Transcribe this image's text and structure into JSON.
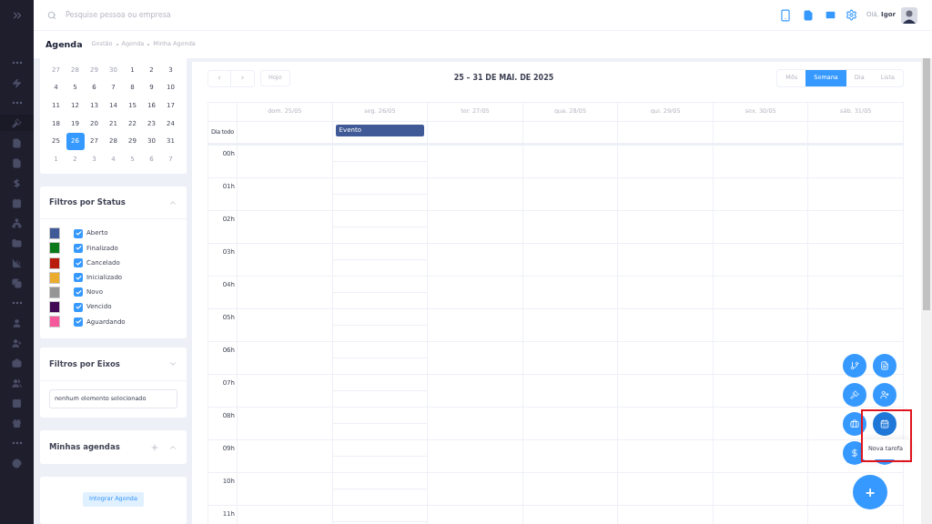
{
  "search": {
    "placeholder": "Pesquise pessoa ou empresa"
  },
  "greeting": "Olá, **Igor**",
  "page": {
    "title": "Agenda",
    "breadcrumb": [
      "Gestão",
      "Agenda",
      "Minha Agenda"
    ]
  },
  "mini_calendar": {
    "weeks": [
      [
        {
          "d": "27",
          "other": true,
          "selected": false
        },
        {
          "d": "28",
          "other": true,
          "selected": false
        },
        {
          "d": "29",
          "other": true,
          "selected": false
        },
        {
          "d": "30",
          "other": true,
          "selected": false
        },
        {
          "d": "1",
          "other": false,
          "selected": false
        },
        {
          "d": "2",
          "other": false,
          "selected": false
        },
        {
          "d": "3",
          "other": false,
          "selected": false
        }
      ],
      [
        {
          "d": "4",
          "other": false,
          "selected": false
        },
        {
          "d": "5",
          "other": false,
          "selected": false
        },
        {
          "d": "6",
          "other": false,
          "selected": false
        },
        {
          "d": "7",
          "other": false,
          "selected": false
        },
        {
          "d": "8",
          "other": false,
          "selected": false
        },
        {
          "d": "9",
          "other": false,
          "selected": false
        },
        {
          "d": "10",
          "other": false,
          "selected": false
        }
      ],
      [
        {
          "d": "11",
          "other": false,
          "selected": false
        },
        {
          "d": "12",
          "other": false,
          "selected": false
        },
        {
          "d": "13",
          "other": false,
          "selected": false
        },
        {
          "d": "14",
          "other": false,
          "selected": false
        },
        {
          "d": "15",
          "other": false,
          "selected": false
        },
        {
          "d": "16",
          "other": false,
          "selected": false
        },
        {
          "d": "17",
          "other": false,
          "selected": false
        }
      ],
      [
        {
          "d": "18",
          "other": false,
          "selected": false
        },
        {
          "d": "19",
          "other": false,
          "selected": false
        },
        {
          "d": "20",
          "other": false,
          "selected": false
        },
        {
          "d": "21",
          "other": false,
          "selected": false
        },
        {
          "d": "22",
          "other": false,
          "selected": false
        },
        {
          "d": "23",
          "other": false,
          "selected": false
        },
        {
          "d": "24",
          "other": false,
          "selected": false
        }
      ],
      [
        {
          "d": "25",
          "other": false,
          "selected": false
        },
        {
          "d": "26",
          "other": false,
          "selected": true
        },
        {
          "d": "27",
          "other": false,
          "selected": false
        },
        {
          "d": "28",
          "other": false,
          "selected": false
        },
        {
          "d": "29",
          "other": false,
          "selected": false
        },
        {
          "d": "30",
          "other": false,
          "selected": false
        },
        {
          "d": "31",
          "other": false,
          "selected": false
        }
      ],
      [
        {
          "d": "1",
          "other": true,
          "selected": false
        },
        {
          "d": "2",
          "other": true,
          "selected": false
        },
        {
          "d": "3",
          "other": true,
          "selected": false
        },
        {
          "d": "4",
          "other": true,
          "selected": false
        },
        {
          "d": "5",
          "other": true,
          "selected": false
        },
        {
          "d": "6",
          "other": true,
          "selected": false
        },
        {
          "d": "7",
          "other": true,
          "selected": false
        }
      ]
    ]
  },
  "status_filter": {
    "title": "Filtros por Status",
    "expanded": true,
    "items": [
      {
        "label": "Aberto",
        "color": "#3f5a96",
        "checked": true
      },
      {
        "label": "Finalizado",
        "color": "#0b7a1a",
        "checked": true
      },
      {
        "label": "Cancelado",
        "color": "#b81c0c",
        "checked": true
      },
      {
        "label": "Inicializado",
        "color": "#ebab2e",
        "checked": true
      },
      {
        "label": "Novo",
        "color": "#959595",
        "checked": true
      },
      {
        "label": "Vencido",
        "color": "#420955",
        "checked": true
      },
      {
        "label": "Aguardando",
        "color": "#f6589c",
        "checked": true
      }
    ]
  },
  "axis_filter": {
    "title": "Filtros por Eixos",
    "expanded": false,
    "value": "nenhum elemento selecionado"
  },
  "my_calendars": {
    "title": "Minhas agendas",
    "expanded": true
  },
  "integrate_button": "Integrar Agenda",
  "toolbar": {
    "prev": "‹",
    "next": "›",
    "today": "Hoje",
    "range": "25 – 31 DE MAI. DE 2025",
    "views": [
      {
        "label": "Mês",
        "selected": false
      },
      {
        "label": "Semana",
        "selected": true
      },
      {
        "label": "Dia",
        "selected": false
      },
      {
        "label": "Lista",
        "selected": false
      }
    ]
  },
  "week": {
    "all_day_label": "Dia todo",
    "days": [
      {
        "label": "dom. 25/05"
      },
      {
        "label": "seg. 26/05",
        "events": [
          {
            "title": "Evento"
          }
        ]
      },
      {
        "label": "ter. 27/05"
      },
      {
        "label": "qua. 28/05"
      },
      {
        "label": "qui. 29/05"
      },
      {
        "label": "sex. 30/05"
      },
      {
        "label": "sáb. 31/05"
      }
    ],
    "hours": [
      "00h",
      "01h",
      "02h",
      "03h",
      "04h",
      "05h",
      "06h",
      "07h",
      "08h",
      "09h",
      "10h",
      "11h"
    ]
  },
  "quick_actions": [
    {
      "kind": "branch",
      "highlighted": false
    },
    {
      "kind": "document",
      "highlighted": false
    },
    {
      "kind": "gavel",
      "highlighted": false
    },
    {
      "kind": "user-plus",
      "highlighted": false
    },
    {
      "kind": "briefcase",
      "highlighted": false
    },
    {
      "kind": "calendar",
      "highlighted": true
    },
    {
      "kind": "dollar",
      "highlighted": false
    },
    {
      "kind": "blank",
      "highlighted": false
    }
  ],
  "tooltip": "Nova tarefa",
  "fab": "+"
}
